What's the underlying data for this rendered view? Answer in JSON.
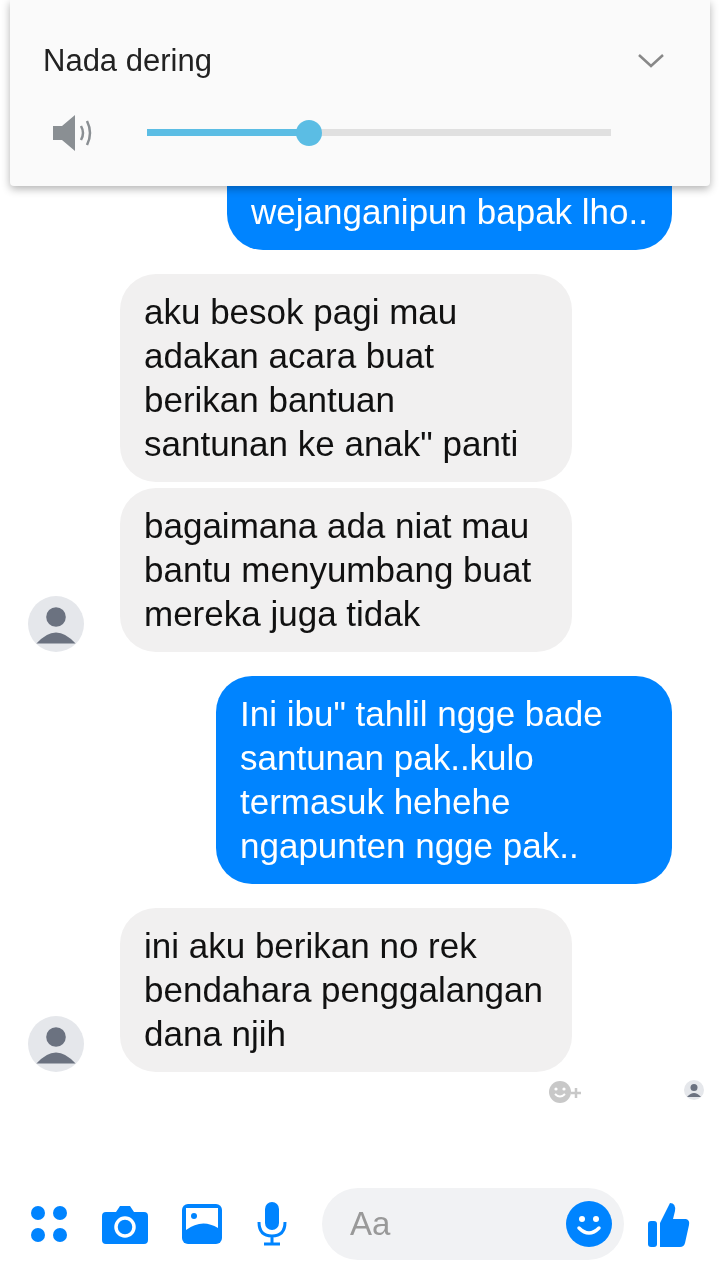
{
  "volume_panel": {
    "title": "Nada dering",
    "level": 0.35
  },
  "messages": [
    {
      "kind": "sent",
      "text": "wejanganipun bapak lho..",
      "avatar": false
    },
    {
      "kind": "received",
      "text": "aku besok pagi mau adakan acara buat berikan bantuan santunan ke anak\" panti",
      "avatar": false
    },
    {
      "kind": "received",
      "text": "bagaimana ada niat mau bantu menyumbang buat mereka juga tidak",
      "avatar": true
    },
    {
      "kind": "sent",
      "text": "Ini ibu\" tahlil ngge bade santunan pak..kulo termasuk hehehe ngapunten ngge pak..",
      "avatar": false
    },
    {
      "kind": "received",
      "text": "ini aku berikan no rek bendahara penggalangan dana njih",
      "avatar": true
    }
  ],
  "composer": {
    "placeholder": "Aa"
  }
}
